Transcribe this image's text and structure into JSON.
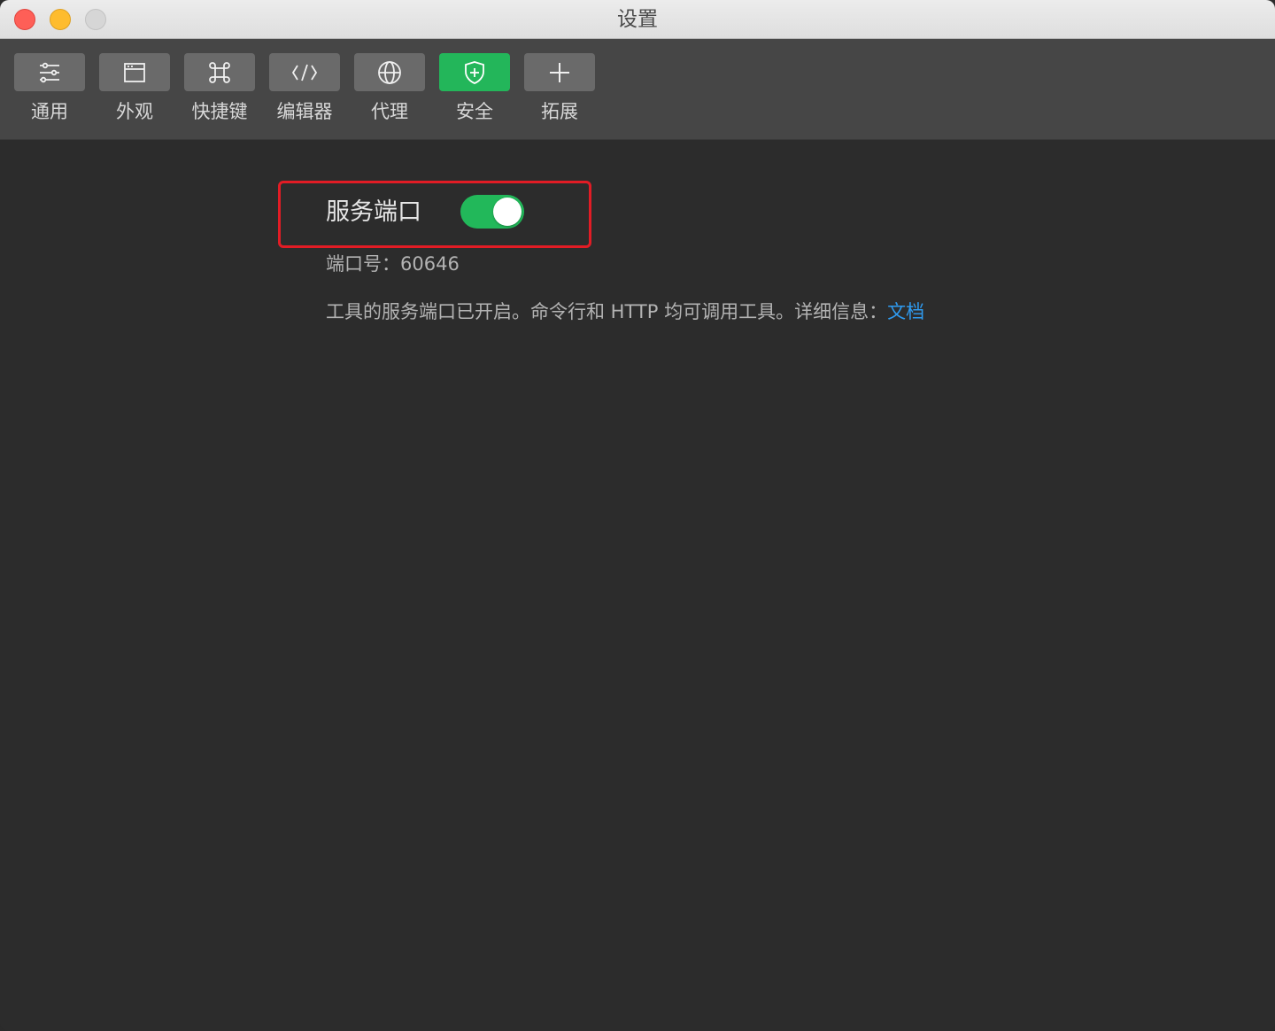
{
  "window": {
    "title": "设置"
  },
  "toolbar": {
    "items": [
      {
        "label": "通用",
        "icon": "sliders-icon",
        "active": false
      },
      {
        "label": "外观",
        "icon": "window-icon",
        "active": false
      },
      {
        "label": "快捷键",
        "icon": "command-key-icon",
        "active": false
      },
      {
        "label": "编辑器",
        "icon": "code-icon",
        "active": false
      },
      {
        "label": "代理",
        "icon": "globe-icon",
        "active": false
      },
      {
        "label": "安全",
        "icon": "shield-plus-icon",
        "active": true
      },
      {
        "label": "拓展",
        "icon": "plus-icon",
        "active": false
      }
    ]
  },
  "security": {
    "service_port_label": "服务端口",
    "service_port_enabled": true,
    "port_text": "端口号：60646",
    "description": "工具的服务端口已开启。命令行和 HTTP 均可调用工具。详细信息：",
    "doc_link": "文档"
  },
  "colors": {
    "accent_green": "#22b85a",
    "highlight_red": "#e21c25",
    "link_blue": "#2f9bf0"
  }
}
